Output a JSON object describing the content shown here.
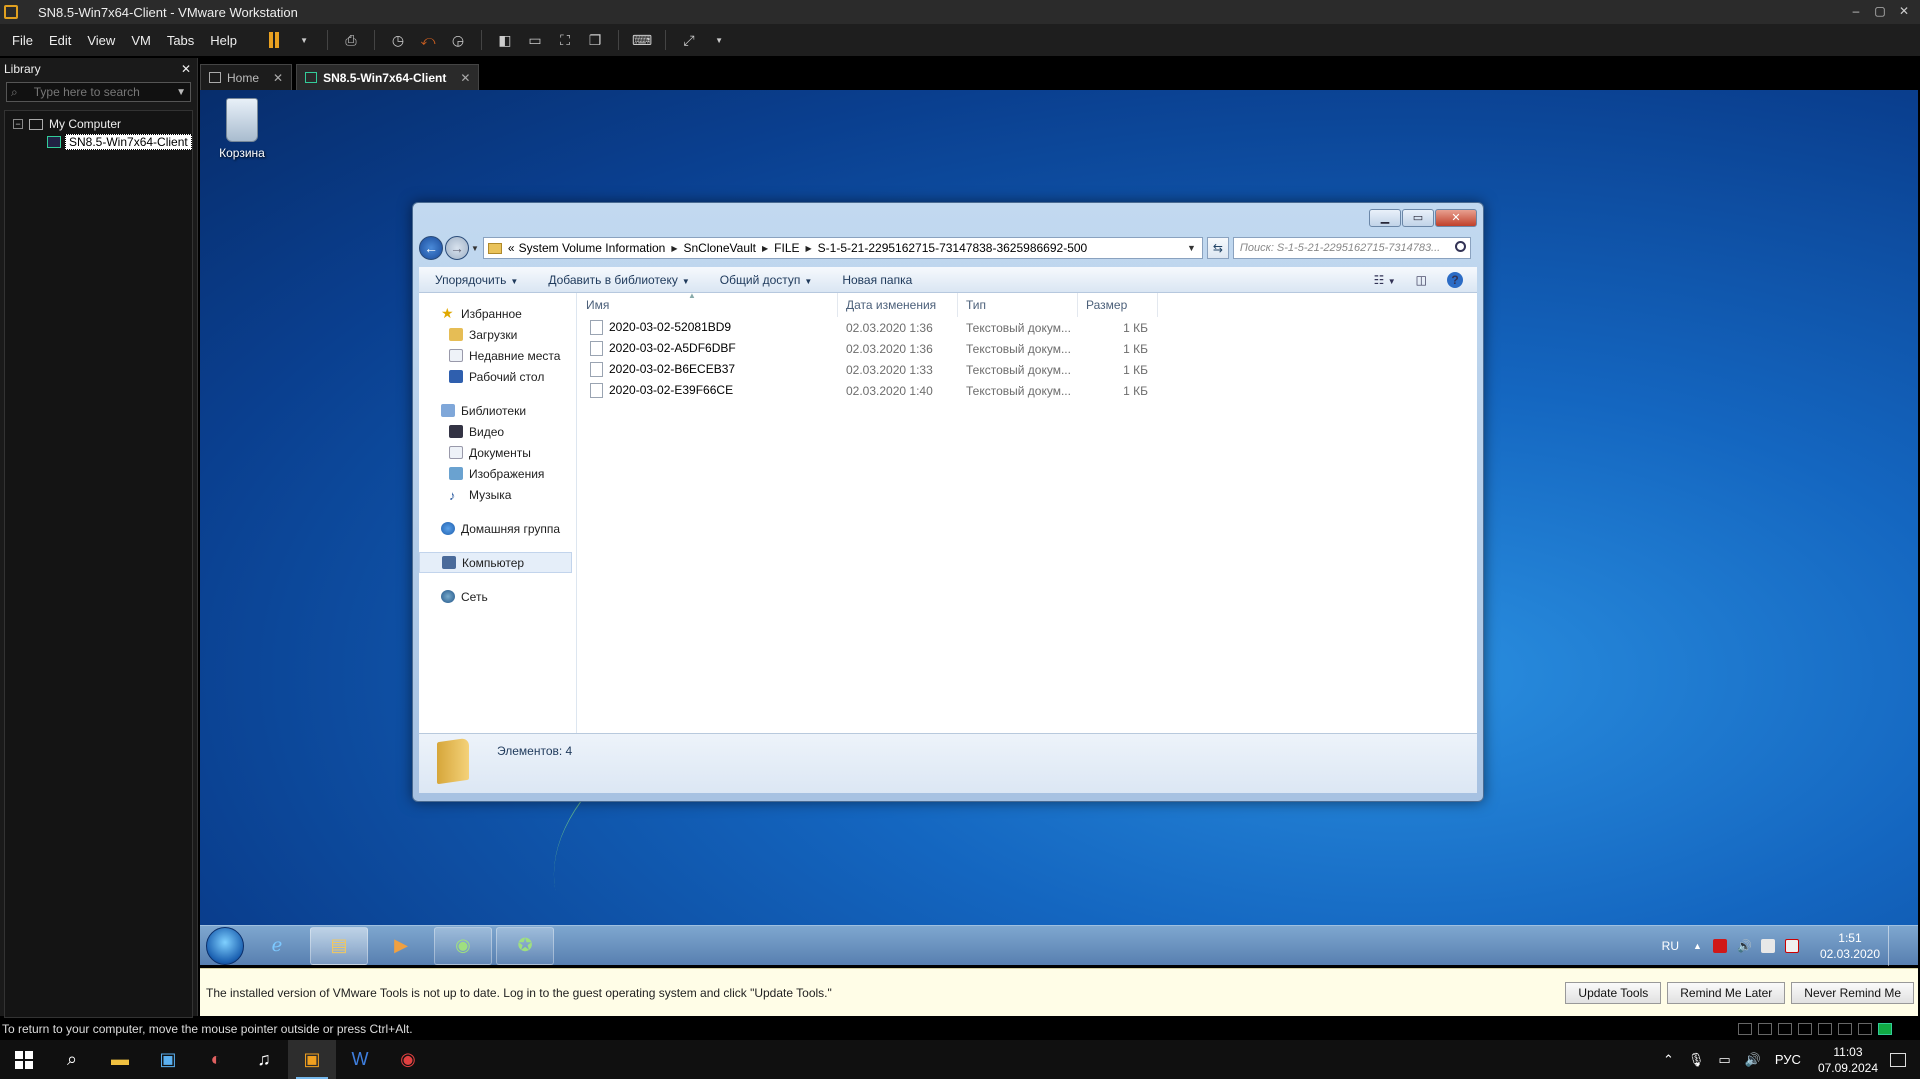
{
  "window": {
    "title": "SN8.5-Win7x64-Client - VMware Workstation",
    "controls": [
      "–",
      "▢",
      "✕"
    ]
  },
  "menu": [
    "File",
    "Edit",
    "View",
    "VM",
    "Tabs",
    "Help"
  ],
  "library": {
    "title": "Library",
    "close": "✕",
    "search_placeholder": "Type here to search",
    "tree": {
      "root": "My Computer",
      "vm": "SN8.5-Win7x64-Client"
    }
  },
  "tabs": [
    {
      "label": "Home",
      "close": "✕"
    },
    {
      "label": "SN8.5-Win7x64-Client",
      "close": "✕"
    }
  ],
  "desktop": {
    "recycle_bin": "Корзина"
  },
  "explorer": {
    "address": {
      "prefix": "«",
      "crumbs": [
        "System Volume Information",
        "SnCloneVault",
        "FILE",
        "S-1-5-21-2295162715-73147838-3625986692-500"
      ]
    },
    "search_placeholder": "Поиск: S-1-5-21-2295162715-7314783...",
    "commands": [
      "Упорядочить",
      "Добавить в библиотеку",
      "Общий доступ",
      "Новая папка"
    ],
    "nav": {
      "favorites": "Избранное",
      "favorites_items": [
        "Загрузки",
        "Недавние места",
        "Рабочий стол"
      ],
      "libraries": "Библиотеки",
      "libraries_items": [
        "Видео",
        "Документы",
        "Изображения",
        "Музыка"
      ],
      "homegroup": "Домашняя группа",
      "computer": "Компьютер",
      "network": "Сеть"
    },
    "columns": [
      "Имя",
      "Дата изменения",
      "Тип",
      "Размер"
    ],
    "files": [
      {
        "name": "2020-03-02-52081BD9",
        "date": "02.03.2020 1:36",
        "type": "Текстовый докум...",
        "size": "1 КБ"
      },
      {
        "name": "2020-03-02-A5DF6DBF",
        "date": "02.03.2020 1:36",
        "type": "Текстовый докум...",
        "size": "1 КБ"
      },
      {
        "name": "2020-03-02-B6ECEB37",
        "date": "02.03.2020 1:33",
        "type": "Текстовый докум...",
        "size": "1 КБ"
      },
      {
        "name": "2020-03-02-E39F66CE",
        "date": "02.03.2020 1:40",
        "type": "Текстовый докум...",
        "size": "1 КБ"
      }
    ],
    "item_count": "Элементов: 4"
  },
  "guest_taskbar": {
    "lang": "RU",
    "time": "1:51",
    "date": "02.03.2020"
  },
  "notification": {
    "message": "The installed version of VMware Tools is not up to date. Log in to the guest operating system and click \"Update Tools.\"",
    "update": "Update Tools",
    "remind_later": "Remind Me Later",
    "never_remind": "Never Remind Me"
  },
  "status": {
    "text": "To return to your computer, move the mouse pointer outside or press Ctrl+Alt."
  },
  "host_taskbar": {
    "lang": "РУС",
    "time": "11:03",
    "date": "07.09.2024"
  },
  "colors": {
    "accent": "#e8a020",
    "desktop_blue": "#1466c0"
  }
}
